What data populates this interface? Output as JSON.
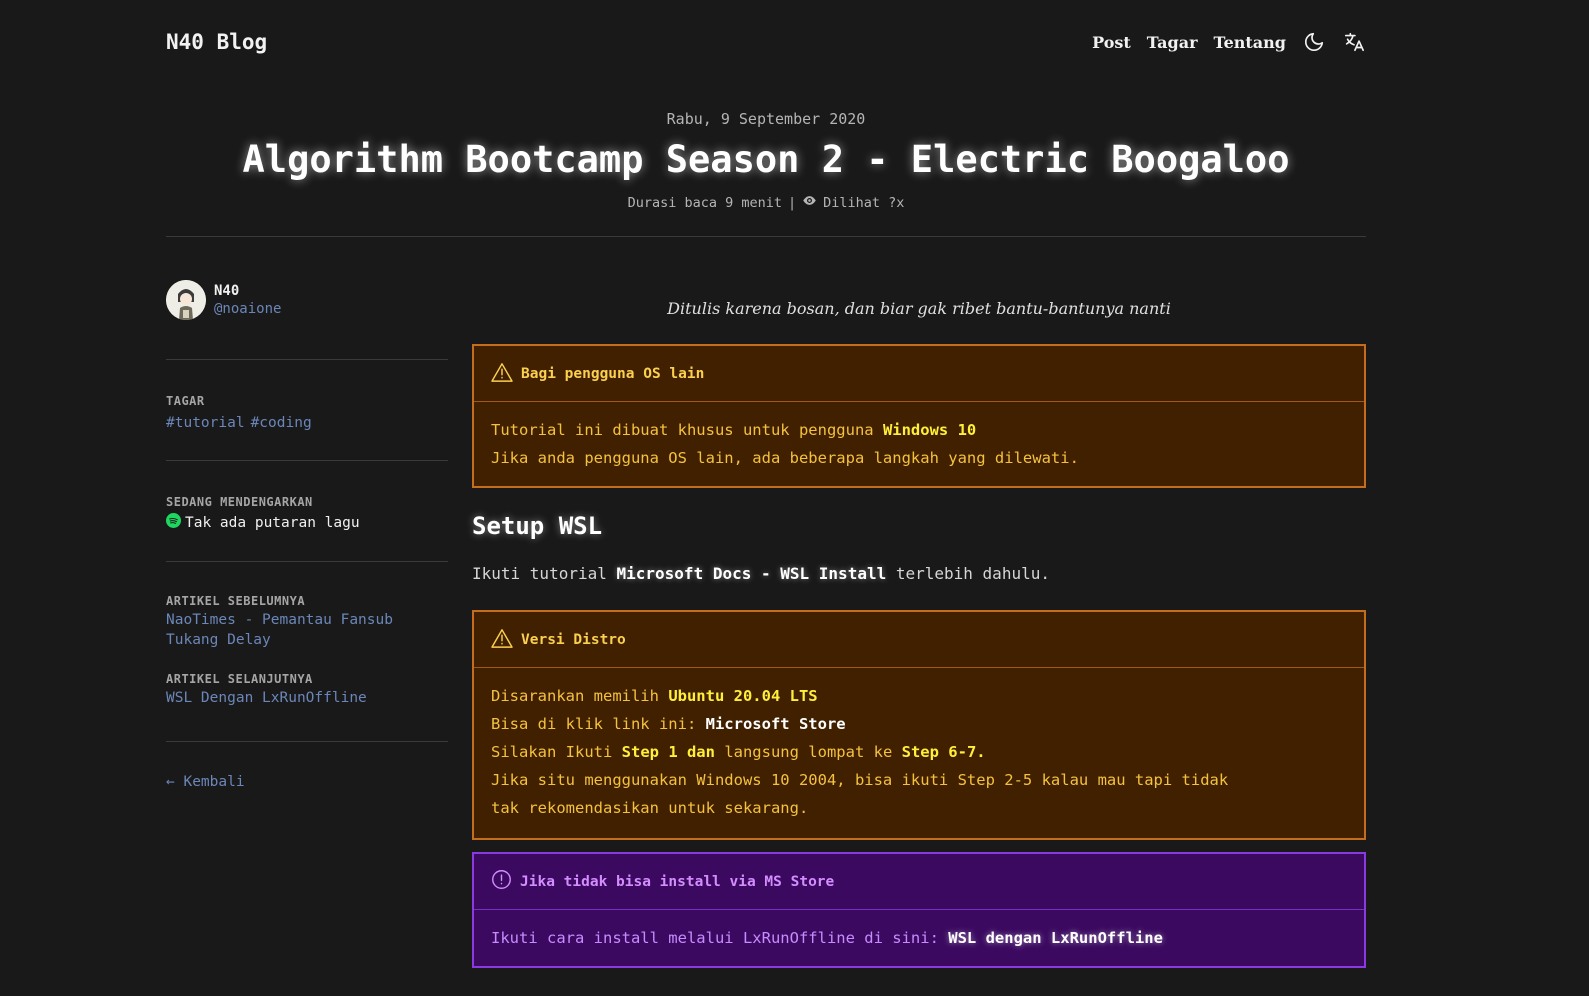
{
  "header": {
    "brand": "N40 Blog",
    "nav": [
      "Post",
      "Tagar",
      "Tentang"
    ],
    "icons": [
      "moon-icon",
      "translate-icon"
    ]
  },
  "post": {
    "date": "Rabu, 9 September 2020",
    "title": "Algorithm Bootcamp Season 2 - Electric Boogaloo",
    "read_time": "Durasi baca 9 menit",
    "separator": "|",
    "views": "Dilihat ?x"
  },
  "sidebar": {
    "author_name": "N40",
    "author_handle": "@noaione",
    "tags_label": "TAGAR",
    "tags": [
      "#tutorial",
      "#coding"
    ],
    "listening_label": "SEDANG MENDENGARKAN",
    "listening_value": "Tak ada putaran lagu",
    "prev_label": "ARTIKEL SEBELUMNYA",
    "prev_title": "NaoTimes - Pemantau Fansub Tukang Delay",
    "next_label": "ARTIKEL SELANJUTNYA",
    "next_title": "WSL Dengan LxRunOffline",
    "back": "← Kembali"
  },
  "content": {
    "lead": "Ditulis karena bosan, dan biar gak ribet bantu-bantunya nanti",
    "callout1": {
      "title": "Bagi pengguna OS lain",
      "l1_pre": "Tutorial ini dibuat khusus untuk pengguna ",
      "l1_hl": "Windows 10",
      "l2": "Jika anda pengguna OS lain, ada beberapa langkah yang dilewati."
    },
    "section_title": "Setup WSL",
    "para_pre": "Ikuti tutorial ",
    "para_link": "Microsoft Docs - WSL Install",
    "para_post": " terlebih dahulu.",
    "callout2": {
      "title": "Versi Distro",
      "l1_pre": "Disarankan memilih ",
      "l1_hl": "Ubuntu 20.04 LTS",
      "l2_pre": "Bisa di klik link ini: ",
      "l2_link": "Microsoft Store",
      "l3_pre": "Silakan Ikuti ",
      "l3_hl1": "Step 1 dan",
      "l3_mid": " langsung lompat ke ",
      "l3_hl2": "Step 6-7.",
      "l4": "Jika situ menggunakan Windows 10 2004, bisa ikuti Step 2-5 kalau mau tapi tidak tak rekomendasikan untuk sekarang."
    },
    "callout3": {
      "title": "Jika tidak bisa install via MS Store",
      "l1_pre": "Ikuti cara install melalui LxRunOffline di sini: ",
      "l1_link": "WSL dengan LxRunOffline"
    }
  },
  "colors": {
    "background": "#191919",
    "link": "#6b86b8",
    "warn_bg": "#412000",
    "warn_border": "#c56d1d",
    "info_bg": "#3b0a60",
    "info_border": "#8a3be0",
    "spotify": "#1ed760"
  }
}
